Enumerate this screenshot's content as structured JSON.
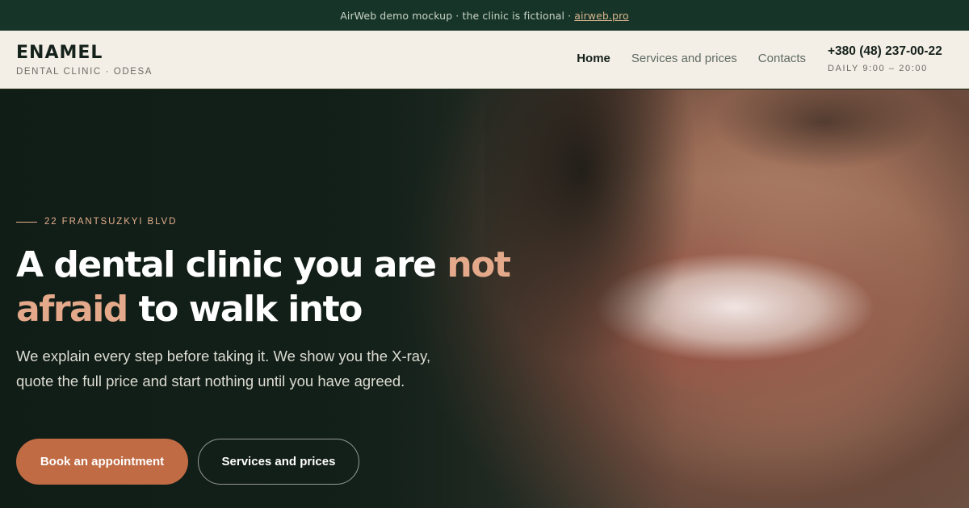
{
  "banner": {
    "text": "AirWeb demo mockup · the clinic is fictional ·",
    "link": "airweb.pro"
  },
  "header": {
    "brand_name": "ENAMEL",
    "brand_sub": "DENTAL CLINIC · ODESA",
    "nav": [
      {
        "label": "Home",
        "active": true
      },
      {
        "label": "Services and prices",
        "active": false
      },
      {
        "label": "Contacts",
        "active": false
      }
    ],
    "phone": "+380 (48) 237-00-22",
    "hours": "DAILY 9:00 – 20:00"
  },
  "hero": {
    "eyebrow": "22 FRANTSUZKYI BLVD",
    "headline_part1": "A dental clinic you are ",
    "headline_accent": "not afraid",
    "headline_part2": " to walk into",
    "lead": "We explain every step before taking it. We show you the X-ray, quote the full price and start nothing until you have agreed.",
    "primary_cta": "Book an appointment",
    "secondary_cta": "Services and prices"
  },
  "colors": {
    "banner_bg": "#163528",
    "header_bg": "#f3efe7",
    "accent": "#e4a98a",
    "cta_bg": "#c06b44"
  }
}
